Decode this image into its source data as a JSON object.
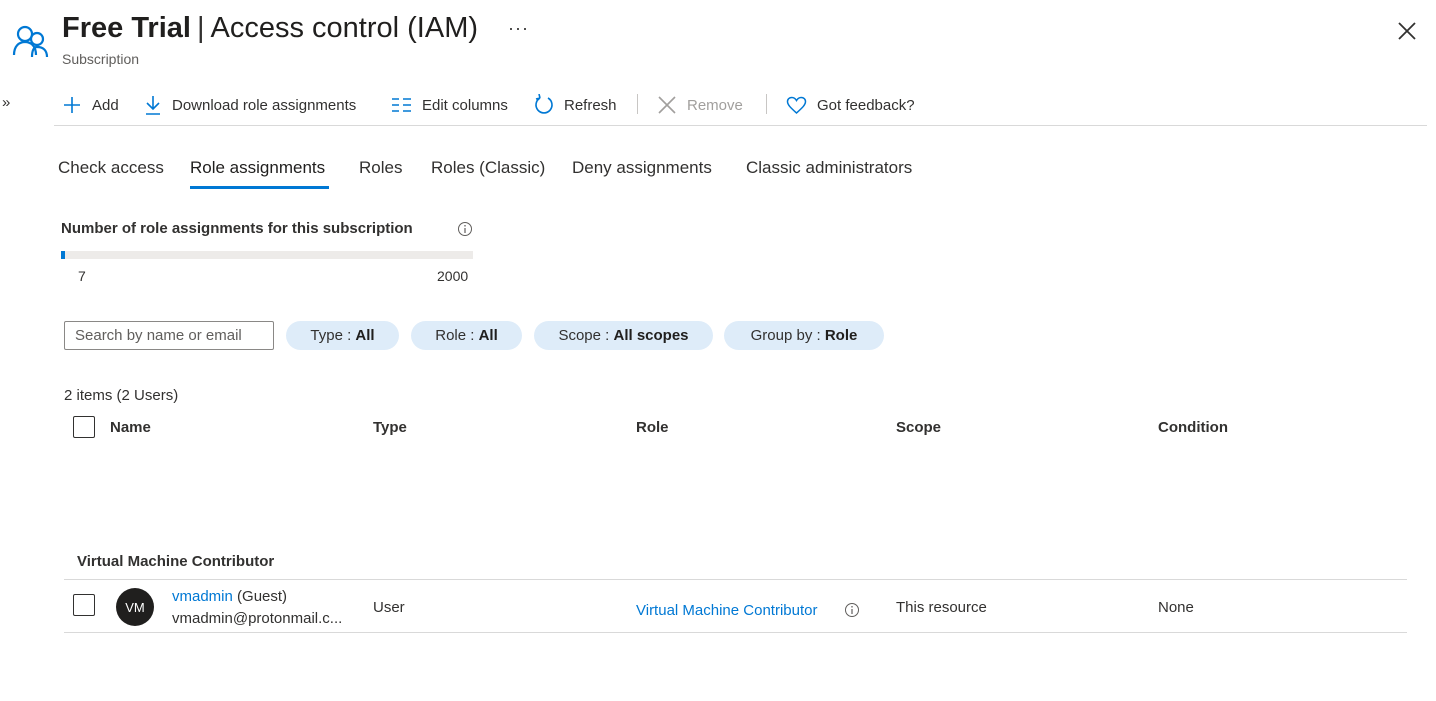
{
  "header": {
    "title_bold": "Free Trial",
    "title_sep": "|",
    "title_rest": "Access control (IAM)",
    "subtitle": "Subscription",
    "more": "···",
    "expand": "»"
  },
  "toolbar": {
    "add": "Add",
    "download": "Download role assignments",
    "edit_columns": "Edit columns",
    "refresh": "Refresh",
    "remove": "Remove",
    "feedback": "Got feedback?"
  },
  "tabs": [
    {
      "label": "Check access"
    },
    {
      "label": "Role assignments"
    },
    {
      "label": "Roles"
    },
    {
      "label": "Roles (Classic)"
    },
    {
      "label": "Deny assignments"
    },
    {
      "label": "Classic administrators"
    }
  ],
  "count": {
    "title": "Number of role assignments for this subscription",
    "current": "7",
    "max": "2000",
    "fraction": 0.0035
  },
  "filters": {
    "search_placeholder": "Search by name or email",
    "type_label": "Type : ",
    "type_value": "All",
    "role_label": "Role : ",
    "role_value": "All",
    "scope_label": "Scope : ",
    "scope_value": "All scopes",
    "groupby_label": "Group by : ",
    "groupby_value": "Role"
  },
  "grid": {
    "items_count": "2 items (2 Users)",
    "columns": [
      "Name",
      "Type",
      "Role",
      "Scope",
      "Condition"
    ],
    "group_title": "Virtual Machine Contributor",
    "rows": [
      {
        "initials": "VM",
        "name": "vmadmin",
        "name_suffix": "(Guest)",
        "email": "vmadmin@protonmail.c...",
        "type": "User",
        "role": "Virtual Machine Contributor",
        "scope": "This resource",
        "condition": "None"
      }
    ]
  },
  "colors": {
    "accent": "#0078d4",
    "pill_bg": "#deecf9",
    "avatar_bg": "#201f1e"
  }
}
